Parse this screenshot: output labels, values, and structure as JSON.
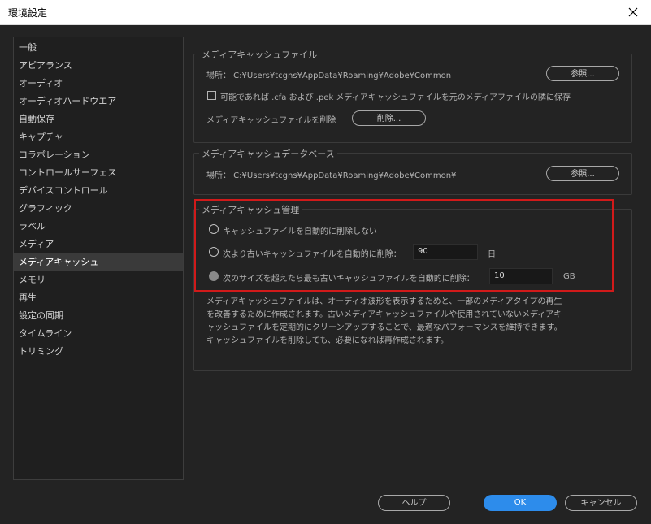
{
  "window": {
    "title": "環境設定"
  },
  "sidebar": {
    "items": [
      {
        "label": "一般"
      },
      {
        "label": "アピアランス"
      },
      {
        "label": "オーディオ"
      },
      {
        "label": "オーディオハードウエア"
      },
      {
        "label": "自動保存"
      },
      {
        "label": "キャプチャ"
      },
      {
        "label": "コラボレーション"
      },
      {
        "label": "コントロールサーフェス"
      },
      {
        "label": "デバイスコントロール"
      },
      {
        "label": "グラフィック"
      },
      {
        "label": "ラベル"
      },
      {
        "label": "メディア"
      },
      {
        "label": "メディアキャッシュ"
      },
      {
        "label": "メモリ"
      },
      {
        "label": "再生"
      },
      {
        "label": "設定の同期"
      },
      {
        "label": "タイムライン"
      },
      {
        "label": "トリミング"
      }
    ],
    "selected": "メディアキャッシュ"
  },
  "cache_files": {
    "title": "メディアキャッシュファイル",
    "location": "場所： C:¥Users¥tcgns¥AppData¥Roaming¥Adobe¥Common",
    "browse_label": "参照...",
    "checkbox_label": "可能であれば .cfa および .pek メディアキャッシュファイルを元のメディアファイルの隣に保存",
    "checkbox_checked": false,
    "delete_text": "メディアキャッシュファイルを削除",
    "delete_button": "削除..."
  },
  "cache_db": {
    "title": "メディアキャッシュデータベース",
    "location": "場所： C:¥Users¥tcgns¥AppData¥Roaming¥Adobe¥Common¥",
    "browse_label": "参照..."
  },
  "cache_mgmt": {
    "title": "メディアキャッシュ管理",
    "option1": "キャッシュファイルを自動的に削除しない",
    "option2": "次より古いキャッシュファイルを自動的に削除：",
    "option2_value": "90",
    "option2_unit": "日",
    "option3": "次のサイズを超えたら最も古いキャッシュファイルを自動的に削除：",
    "option3_value": "10",
    "option3_unit": "GB",
    "selected_option": 3
  },
  "description": "メディアキャッシュファイルは、オーディオ波形を表示するためと、一部のメディアタイプの再生を改善するために作成されます。古いメディアキャッシュファイルや使用されていないメディアキャッシュファイルを定期的にクリーンアップすることで、最適なパフォーマンスを維持できます。キャッシュファイルを削除しても、必要になれば再作成されます。",
  "footer": {
    "help": "ヘルプ",
    "ok": "OK",
    "cancel": "キャンセル"
  },
  "colors": {
    "accent": "#2d8ceb",
    "highlight": "#d11a1a"
  },
  "icons": {
    "close": "close-icon"
  }
}
